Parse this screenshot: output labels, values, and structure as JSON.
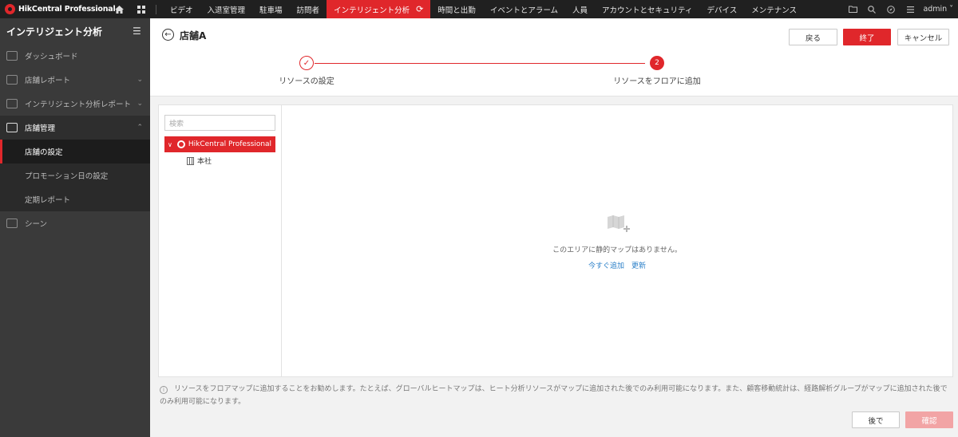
{
  "topbar": {
    "logo_text": "HikCentral Professional",
    "nav": [
      {
        "label": "ビデオ"
      },
      {
        "label": "入退室管理"
      },
      {
        "label": "駐車場"
      },
      {
        "label": "訪問者"
      },
      {
        "label": "インテリジェント分析",
        "active": true
      },
      {
        "label": "時間と出勤"
      },
      {
        "label": "イベントとアラーム"
      },
      {
        "label": "人員"
      },
      {
        "label": "アカウントとセキュリティ"
      },
      {
        "label": "デバイス"
      },
      {
        "label": "メンテナンス"
      }
    ],
    "user": "admin"
  },
  "sidebar": {
    "title": "インテリジェント分析",
    "items": [
      {
        "label": "ダッシュボード"
      },
      {
        "label": "店舗レポート"
      },
      {
        "label": "インテリジェント分析レポート"
      },
      {
        "label": "店舗管理"
      },
      {
        "label": "シーン"
      }
    ],
    "sub": [
      {
        "label": "店舗の設定"
      },
      {
        "label": "プロモーション日の設定"
      },
      {
        "label": "定期レポート"
      }
    ]
  },
  "header": {
    "title": "店舗A",
    "back_label": "戻る",
    "finish_label": "終了",
    "cancel_label": "キャンセル"
  },
  "steps": {
    "step1_label": "リソースの設定",
    "step2_number": "2",
    "step2_label": "リソースをフロアに追加"
  },
  "tree": {
    "search_placeholder": "検索",
    "root_label": "HikCentral Professional",
    "child_label": "本社"
  },
  "map": {
    "empty_text": "このエリアに静的マップはありません。",
    "add_now": "今すぐ追加",
    "refresh": "更新"
  },
  "footer": {
    "hint": "リソースをフロアマップに追加することをお勧めします。たとえば、グローバルヒートマップは、ヒート分析リソースがマップに追加された後でのみ利用可能になります。また、顧客移動統計は、経路解析グループがマップに追加された後でのみ利用可能になります。",
    "later_label": "後で",
    "confirm_label": "確認"
  }
}
